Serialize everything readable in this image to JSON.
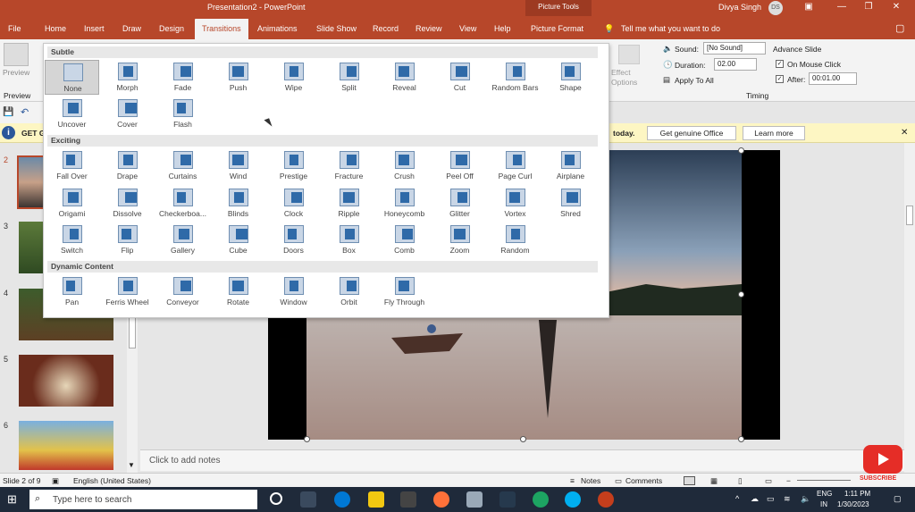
{
  "window": {
    "title": "Presentation2 - PowerPoint",
    "contextual_tab": "Picture Tools",
    "user_name": "Divya Singh",
    "user_initials": "DS",
    "minimize": "▭",
    "restore": "❐",
    "close": "✕"
  },
  "tabs": [
    {
      "label": "File"
    },
    {
      "label": "Home"
    },
    {
      "label": "Insert"
    },
    {
      "label": "Draw"
    },
    {
      "label": "Design"
    },
    {
      "label": "Transitions"
    },
    {
      "label": "Animations"
    },
    {
      "label": "Slide Show"
    },
    {
      "label": "Record"
    },
    {
      "label": "Review"
    },
    {
      "label": "View"
    },
    {
      "label": "Help"
    },
    {
      "label": "Picture Format"
    }
  ],
  "tell_me": "Tell me what you want to do",
  "ribbon": {
    "preview_label": "Preview",
    "preview_group": "Preview",
    "effect_options": "Effect Options",
    "sound_label": "Sound:",
    "sound_value": "[No Sound]",
    "duration_label": "Duration:",
    "duration_value": "02.00",
    "apply_all": "Apply To All",
    "advance_slide": "Advance Slide",
    "on_mouse_click": "On Mouse Click",
    "after_label": "After:",
    "after_value": "00:01.00",
    "timing_group": "Timing"
  },
  "message_bar": {
    "prefix": "GET G",
    "suffix": "today.",
    "genuine_button": "Get genuine Office",
    "learn_more_button": "Learn more",
    "close": "✕"
  },
  "gallery": {
    "sections": [
      {
        "title": "Subtle",
        "items": [
          "None",
          "Morph",
          "Fade",
          "Push",
          "Wipe",
          "Split",
          "Reveal",
          "Cut",
          "Random Bars",
          "Shape",
          "Uncover",
          "Cover",
          "Flash"
        ]
      },
      {
        "title": "Exciting",
        "items": [
          "Fall Over",
          "Drape",
          "Curtains",
          "Wind",
          "Prestige",
          "Fracture",
          "Crush",
          "Peel Off",
          "Page Curl",
          "Airplane",
          "Origami",
          "Dissolve",
          "Checkerboa...",
          "Blinds",
          "Clock",
          "Ripple",
          "Honeycomb",
          "Glitter",
          "Vortex",
          "Shred",
          "Switch",
          "Flip",
          "Gallery",
          "Cube",
          "Doors",
          "Box",
          "Comb",
          "Zoom",
          "Random"
        ]
      },
      {
        "title": "Dynamic Content",
        "items": [
          "Pan",
          "Ferris Wheel",
          "Conveyor",
          "Rotate",
          "Window",
          "Orbit",
          "Fly Through"
        ]
      }
    ]
  },
  "thumbnails": [
    {
      "num": "2"
    },
    {
      "num": "3"
    },
    {
      "num": "4"
    },
    {
      "num": "5"
    },
    {
      "num": "6"
    }
  ],
  "notes_placeholder": "Click to add notes",
  "status": {
    "slide": "Slide 2 of 9",
    "language": "English (United States)",
    "notes": "Notes",
    "comments": "Comments"
  },
  "taskbar": {
    "search_placeholder": "Type here to search",
    "lang": "ENG",
    "region": "IN",
    "time": "1:11 PM",
    "date": "1/30/2023"
  },
  "youtube": {
    "label": "SUBSCRIBE"
  }
}
